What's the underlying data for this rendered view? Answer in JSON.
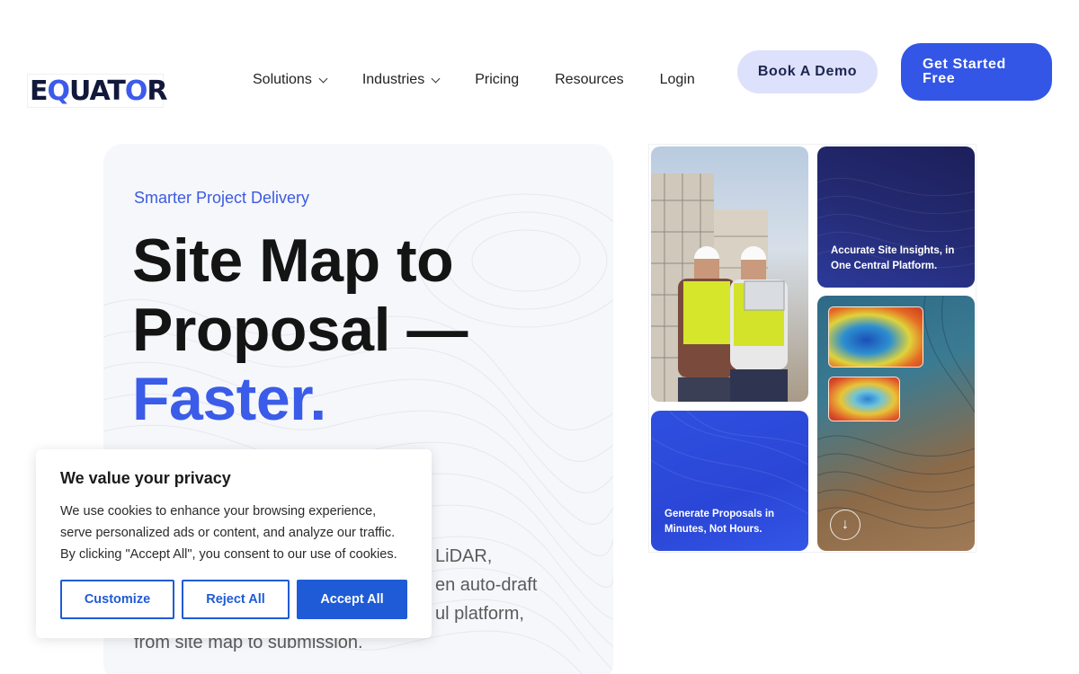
{
  "brand": {
    "logo_text": "EQUATOR",
    "accent_color": "#3356e6"
  },
  "nav": {
    "items": [
      {
        "label": "Solutions",
        "has_dropdown": true
      },
      {
        "label": "Industries",
        "has_dropdown": true
      },
      {
        "label": "Pricing",
        "has_dropdown": false
      },
      {
        "label": "Resources",
        "has_dropdown": false
      },
      {
        "label": "Login",
        "has_dropdown": false
      }
    ],
    "book_demo": "Book A Demo",
    "get_started": "Get Started Free"
  },
  "hero": {
    "eyebrow": "Smarter Project Delivery",
    "headline_line1": "Site Map to",
    "headline_line2": "Proposal —",
    "headline_accent": "Faster.",
    "body_visible_lines": [
      "LiDAR,",
      "en auto-draft",
      "ul platform,",
      "from site map to submission."
    ]
  },
  "gallery": {
    "dark_tile_caption": "Accurate Site Insights, in One Central Platform.",
    "blue_tile_caption": "Generate Proposals in Minutes, Not Hours.",
    "down_icon": "arrow-down-icon"
  },
  "cookie_banner": {
    "title": "We value your privacy",
    "text": "We use cookies to enhance your browsing experience, serve personalized ads or content, and analyze our traffic. By clicking \"Accept All\", you consent to our use of cookies.",
    "customize": "Customize",
    "reject": "Reject All",
    "accept": "Accept All",
    "button_color": "#1f5bd6"
  }
}
